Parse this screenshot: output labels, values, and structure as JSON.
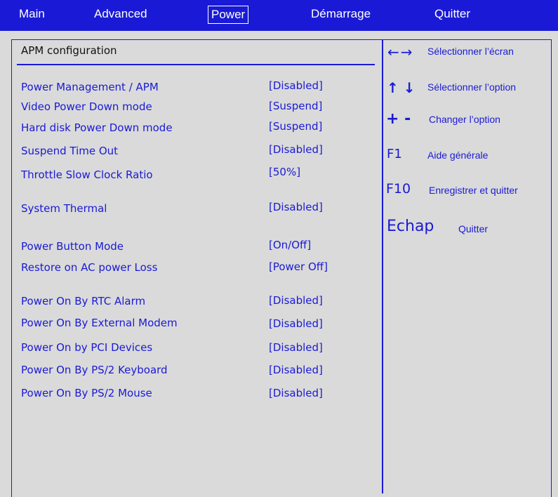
{
  "menu": {
    "items": [
      {
        "label": "Main"
      },
      {
        "label": "Advanced"
      },
      {
        "label": "Power"
      },
      {
        "label": "Démarrage"
      },
      {
        "label": "Quitter"
      }
    ],
    "active": "Power"
  },
  "section": {
    "title": "APM configuration"
  },
  "settings": [
    {
      "label": "Power Management / APM",
      "value": "[Disabled]"
    },
    {
      "label": "Video Power Down mode",
      "value": "[Suspend]"
    },
    {
      "label": "Hard disk Power Down mode",
      "value": "[Suspend]"
    },
    {
      "label": "Suspend Time Out",
      "value": "[Disabled]"
    },
    {
      "label": "Throttle Slow Clock Ratio",
      "value": "[50%]"
    },
    {
      "label": "System Thermal",
      "value": "[Disabled]"
    },
    {
      "label": "Power Button Mode",
      "value": "[On/Off]"
    },
    {
      "label": "Restore on AC power Loss",
      "value": "[Power Off]"
    },
    {
      "label": "Power On By RTC Alarm",
      "value": "[Disabled]"
    },
    {
      "label": "Power On By External Modem",
      "value": "[Disabled]"
    },
    {
      "label": "Power On by PCI Devices",
      "value": "[Disabled]"
    },
    {
      "label": "Power On By PS/2 Keyboard",
      "value": "[Disabled]"
    },
    {
      "label": "Power On By PS/2 Mouse",
      "value": "[Disabled]"
    }
  ],
  "help": [
    {
      "key": "←→",
      "desc": "Sélectionner l’écran"
    },
    {
      "key": "↑ ↓",
      "desc": "Sélectionner l’option"
    },
    {
      "key": "+ -",
      "desc": "Changer l’option"
    },
    {
      "key": "F1",
      "desc": "Aide générale"
    },
    {
      "key": "F10",
      "desc": "Enregistrer et quitter"
    },
    {
      "key": "Echap",
      "desc": "Quitter"
    }
  ],
  "colors": {
    "accent": "#1a1ad6",
    "background": "#dadada",
    "menu_text": "#ffffff"
  }
}
